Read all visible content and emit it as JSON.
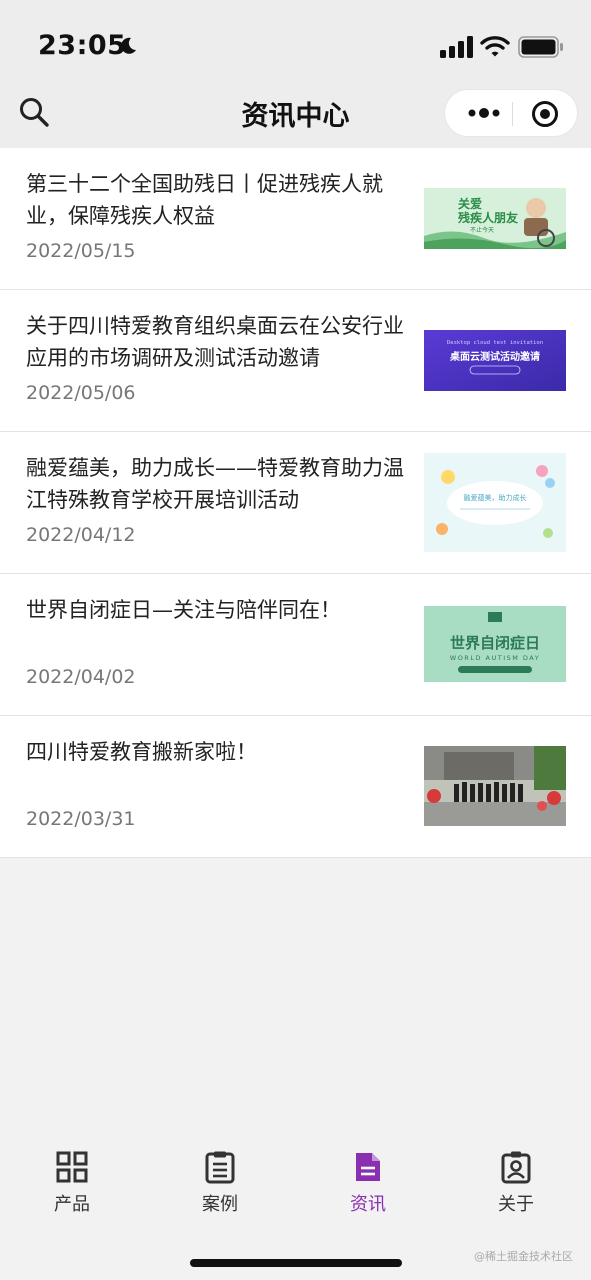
{
  "status": {
    "time": "23:05"
  },
  "nav": {
    "title": "资讯中心"
  },
  "articles": [
    {
      "title": "第三十二个全国助残日丨促进残疾人就业，保障残疾人权益",
      "date": "2022/05/15",
      "thumb_text_1": "关爱",
      "thumb_text_2": "残疾人朋友",
      "thumb_text_3": "不止今天"
    },
    {
      "title": "关于四川特爱教育组织桌面云在公安行业应用的市场调研及测试活动邀请",
      "date": "2022/05/06",
      "thumb_text_1": "Desktop cloud test invitation",
      "thumb_text_2": "桌面云测试活动邀请"
    },
    {
      "title": "融爱蕴美，助力成长——特爱教育助力温江特殊教育学校开展培训活动",
      "date": "2022/04/12",
      "thumb_text_1": "融爱蕴美，助力成长"
    },
    {
      "title": "世界自闭症日—关注与陪伴同在！",
      "date": "2022/04/02",
      "thumb_text_1": "世界自闭症日",
      "thumb_text_2": "WORLD AUTISM DAY"
    },
    {
      "title": "四川特爱教育搬新家啦！",
      "date": "2022/03/31"
    }
  ],
  "tabs": [
    {
      "label": "产品",
      "icon": "grid-icon"
    },
    {
      "label": "案例",
      "icon": "clipboard-icon"
    },
    {
      "label": "资讯",
      "icon": "document-icon",
      "active": true
    },
    {
      "label": "关于",
      "icon": "badge-icon"
    }
  ],
  "colors": {
    "accent": "#8a2fb0",
    "nav_bg": "#ededed",
    "page_bg": "#f2f2f2"
  },
  "watermark": "@稀土掘金技术社区"
}
